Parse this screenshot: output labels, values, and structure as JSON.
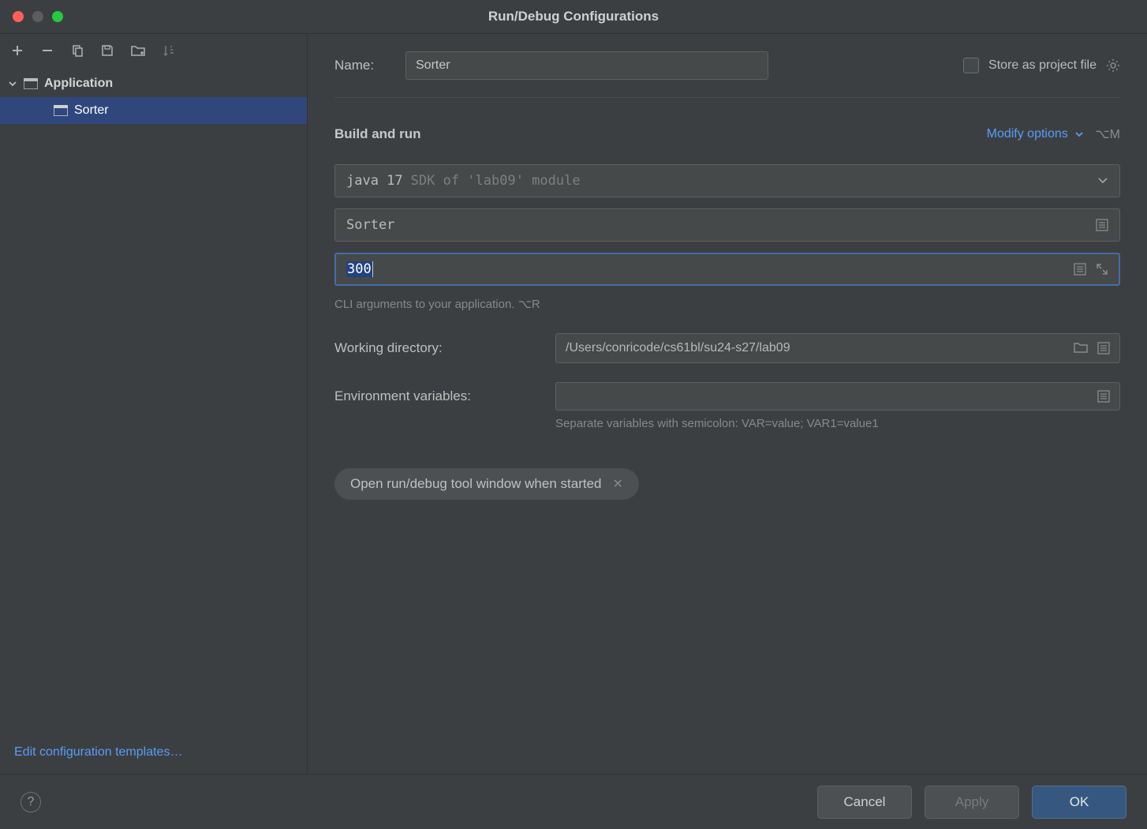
{
  "window": {
    "title": "Run/Debug Configurations"
  },
  "sidebar": {
    "root": "Application",
    "selected": "Sorter",
    "edit_templates": "Edit configuration templates…"
  },
  "form": {
    "name_label": "Name:",
    "name_value": "Sorter",
    "store_as_project": "Store as project file"
  },
  "build_run": {
    "section": "Build and run",
    "modify_options": "Modify options",
    "modify_shortcut": "⌥M",
    "jdk_main": "java 17",
    "jdk_sub": "SDK of 'lab09' module",
    "main_class": "Sorter",
    "cli_args": "300",
    "cli_hint": "CLI arguments to your application. ⌥R",
    "wd_label": "Working directory:",
    "wd_value": "/Users/conricode/cs61bl/su24-s27/lab09",
    "env_label": "Environment variables:",
    "env_value": "",
    "env_hint": "Separate variables with semicolon: VAR=value; VAR1=value1",
    "chip": "Open run/debug tool window when started"
  },
  "footer": {
    "cancel": "Cancel",
    "apply": "Apply",
    "ok": "OK"
  }
}
